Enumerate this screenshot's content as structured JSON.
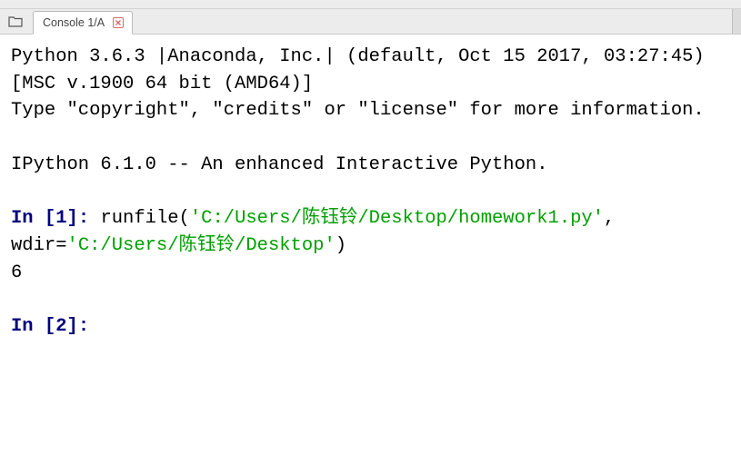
{
  "tab": {
    "label": "Console 1/A"
  },
  "console": {
    "banner_line1": "Python 3.6.3 |Anaconda, Inc.| (default, Oct 15 2017, 03:27:45) [MSC v.1900 64 bit (AMD64)]",
    "banner_line2": "Type \"copyright\", \"credits\" or \"license\" for more information.",
    "ipython_banner": "IPython 6.1.0 -- An enhanced Interactive Python.",
    "in_label": "In [",
    "in_close": "]: ",
    "prompt1_num": "1",
    "prompt2_num": "2",
    "cmd_pre": "runfile(",
    "str1": "'C:/Users/陈钰铃/Desktop/homework1.py'",
    "cmd_mid": ", wdir=",
    "str2": "'C:/Users/陈钰铃/Desktop'",
    "cmd_post": ")",
    "output1": "6"
  }
}
